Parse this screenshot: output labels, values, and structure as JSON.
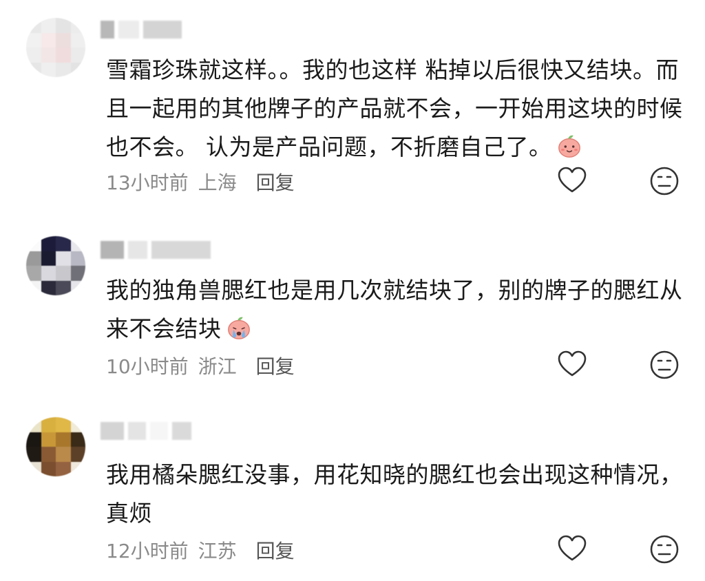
{
  "comments": [
    {
      "text": "雪霜珍珠就这样。。我的也这样 粘掉以后很快又结块。而且一起用的其他牌子的产品就不会，一开始用这块的时候也不会。 认为是产品问题，不折磨自己了。",
      "time": "13小时前",
      "location": "上海",
      "reply": "回复",
      "emoji": "peach-smile-emoji"
    },
    {
      "text": "我的独角兽腮红也是用几次就结块了，别的牌子的腮红从来不会结块",
      "time": "10小时前",
      "location": "浙江",
      "reply": "回复",
      "emoji": "peach-crying-emoji"
    },
    {
      "text": "我用橘朵腮红没事，用花知晓的腮红也会出现这种情况，真烦",
      "time": "12小时前",
      "location": "江苏",
      "reply": "回复",
      "emoji": ""
    }
  ],
  "colors": {
    "text": "#1a1a1a",
    "meta": "#8a8a8a",
    "icon": "#333333"
  }
}
